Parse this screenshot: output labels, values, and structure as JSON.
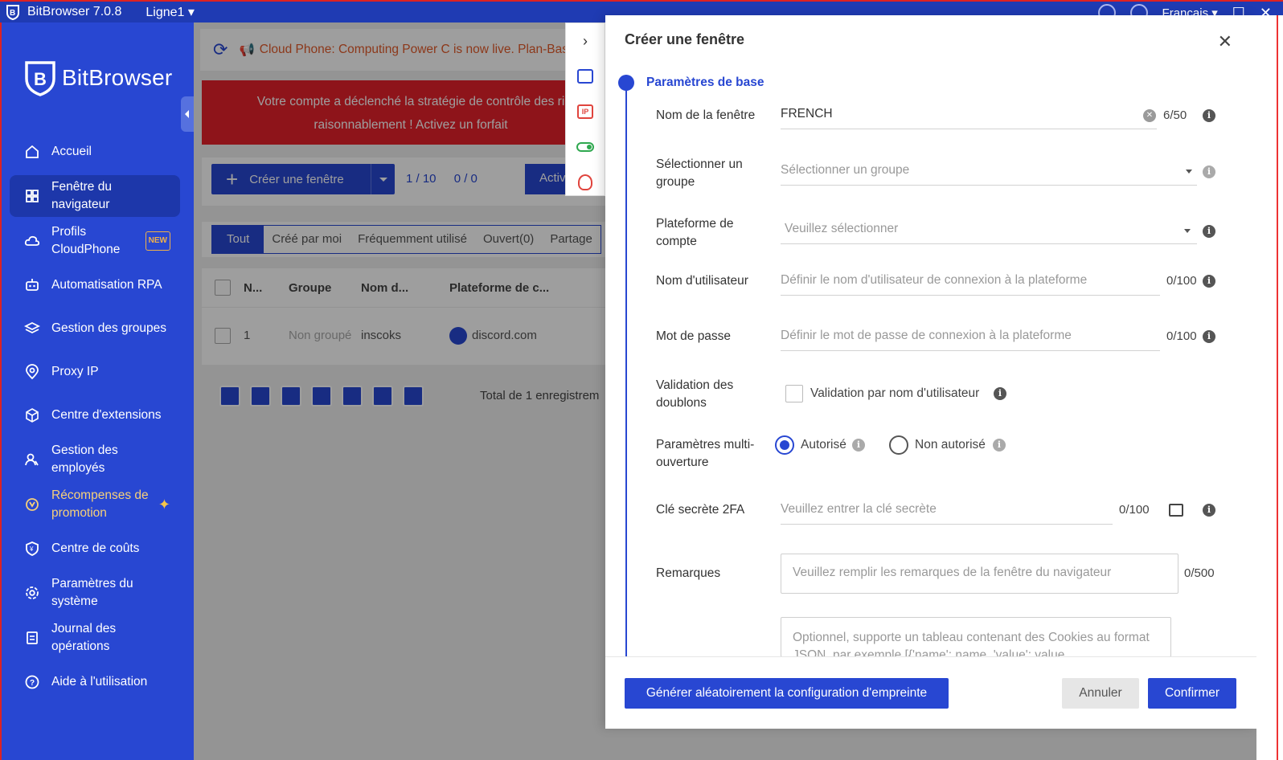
{
  "titlebar": {
    "app": "BitBrowser 7.0.8",
    "line": "Ligne1 ▾",
    "lang": "Français ▾",
    "maximize": "☐",
    "close": "✕"
  },
  "sidebar": {
    "brand": "BitBrowser",
    "items": [
      {
        "label": "Accueil",
        "icon": "home-icon"
      },
      {
        "label": "Fenêtre du navigateur",
        "icon": "grid-icon",
        "active": true
      },
      {
        "label": "Profils CloudPhone",
        "icon": "cloud-icon",
        "badge": "NEW"
      },
      {
        "label": "Automatisation RPA",
        "icon": "robot-icon"
      },
      {
        "label": "Gestion des groupes",
        "icon": "layers-icon"
      },
      {
        "label": "Proxy IP",
        "icon": "location-icon"
      },
      {
        "label": "Centre d'extensions",
        "icon": "cube-icon"
      },
      {
        "label": "Gestion des employés",
        "icon": "users-icon"
      },
      {
        "label": "Récompenses de promotion",
        "icon": "gift-icon"
      },
      {
        "label": "Centre de coûts",
        "icon": "shield-icon"
      },
      {
        "label": "Paramètres du système",
        "icon": "gear-icon"
      },
      {
        "label": "Journal des opérations",
        "icon": "log-icon"
      },
      {
        "label": "Aide à l'utilisation",
        "icon": "help-icon"
      }
    ]
  },
  "main": {
    "announcement": "Cloud Phone: Computing Power C is now live. Plan-Bas",
    "alert_line1": "Votre compte a déclenché la stratégie de contrôle des ri",
    "alert_line2": "raisonnablement ! Activez un forfait",
    "create_button": "Créer une fenêtre",
    "count1": "1 / 10",
    "count2": "0 / 0",
    "activate_button": "Activ",
    "tabs": [
      "Tout",
      "Créé par moi",
      "Fréquemment utilisé",
      "Ouvert(0)",
      "Partage"
    ],
    "columns": [
      "N...",
      "Groupe",
      "Nom d...",
      "Plateforme de c..."
    ],
    "row": {
      "num": "1",
      "group": "Non groupé",
      "name": "inscoks",
      "platform": "discord.com"
    },
    "total": "Total de 1 enregistrem"
  },
  "drawer": {
    "title": "Créer une fenêtre",
    "close": "✕",
    "section": "Paramètres de base",
    "name_label": "Nom de la fenêtre",
    "name_value": "FRENCH",
    "name_counter": "6/50",
    "group_label": "Sélectionner un groupe",
    "group_placeholder": "Sélectionner un groupe",
    "platform_label": "Plateforme de compte",
    "platform_placeholder": "Veuillez sélectionner",
    "username_label": "Nom d'utilisateur",
    "username_placeholder": "Définir le nom d'utilisateur de connexion à la plateforme",
    "username_counter": "0/100",
    "password_label": "Mot de passe",
    "password_placeholder": "Définir le mot de passe de connexion à la plateforme",
    "password_counter": "0/100",
    "dedup_label": "Validation des doublons",
    "dedup_option": "Validation par nom d'utilisateur",
    "multi_label": "Paramètres multi-ouverture",
    "multi_allowed": "Autorisé",
    "multi_denied": "Non autorisé",
    "twofa_label": "Clé secrète 2FA",
    "twofa_placeholder": "Veuillez entrer la clé secrète",
    "twofa_counter": "0/100",
    "notes_label": "Remarques",
    "notes_placeholder": "Veuillez remplir les remarques de la fenêtre du navigateur",
    "notes_counter": "0/500",
    "cookies_placeholder": "Optionnel, supporte un tableau contenant des Cookies au format JSON, par exemple [{'name': name, 'value': value,",
    "btn_generate": "Générer aléatoirement la configuration d'empreinte",
    "btn_cancel": "Annuler",
    "btn_confirm": "Confirmer"
  },
  "colors": {
    "primary": "#2847d2",
    "sidebar": "#2847d2",
    "alert": "#e5212b",
    "announce": "#e35b2b"
  }
}
